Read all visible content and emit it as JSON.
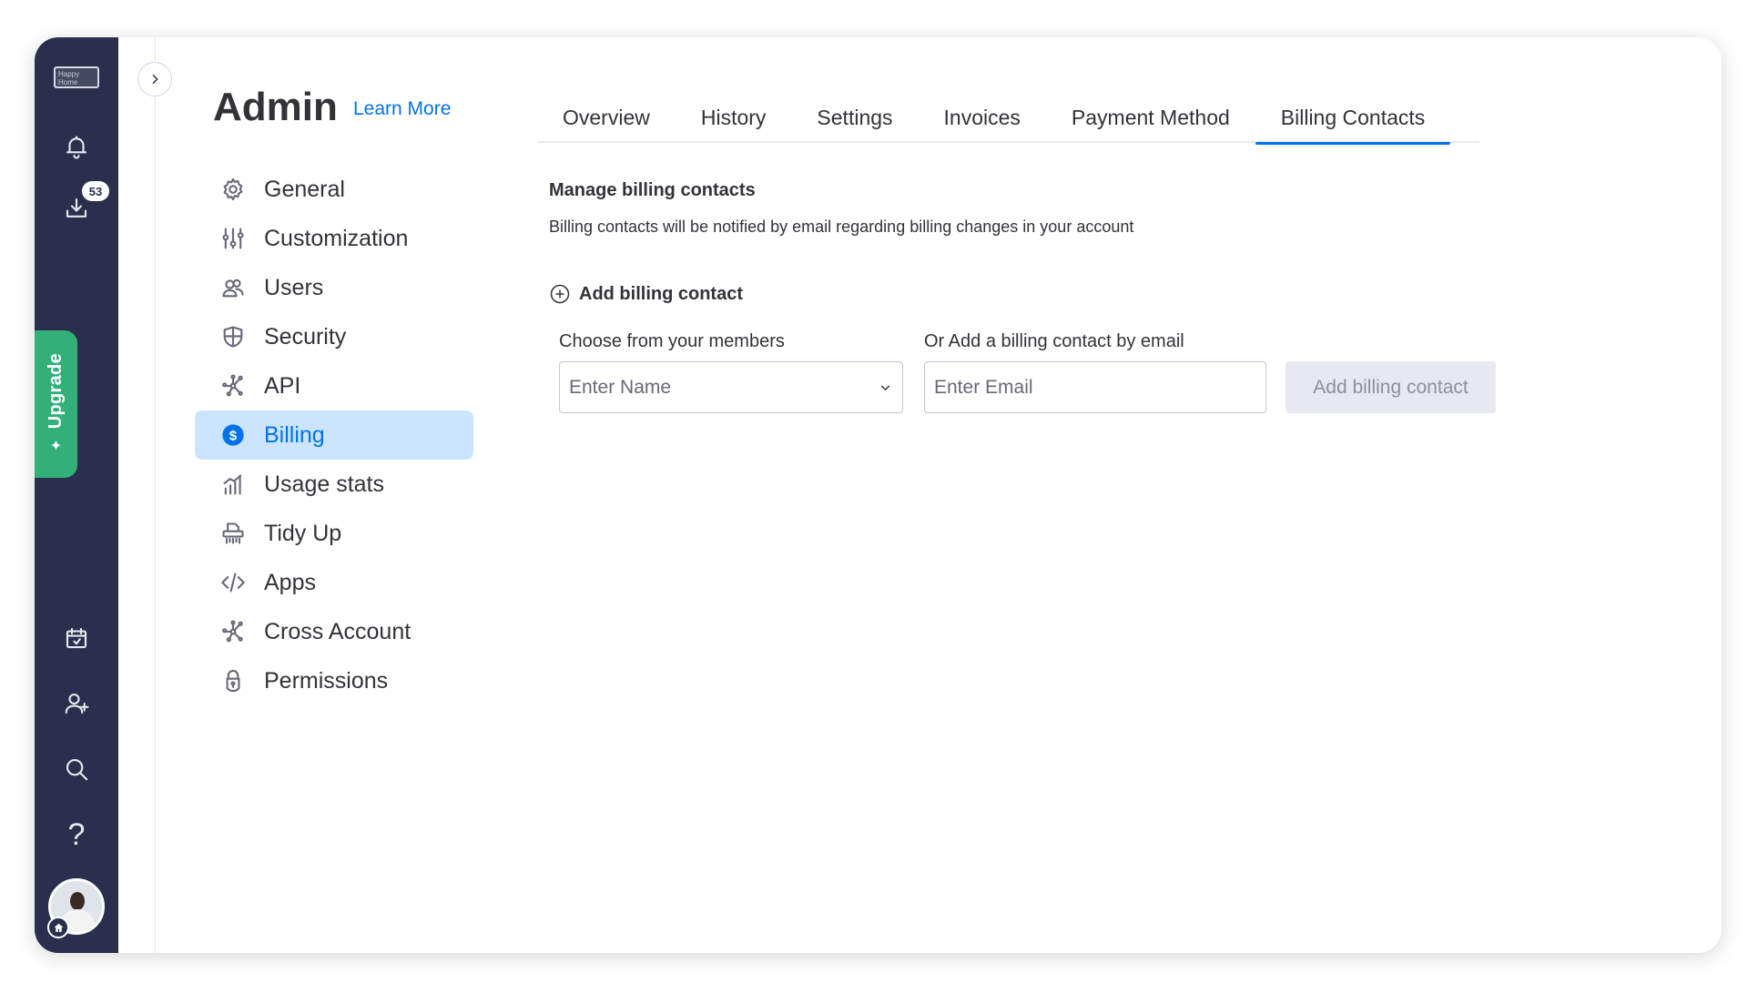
{
  "rail": {
    "logo_text": "Happy Home",
    "notification_count": "53",
    "upgrade_label": "Upgrade",
    "help_label": "?"
  },
  "header": {
    "title": "Admin",
    "learn_more": "Learn More"
  },
  "nav": {
    "items": [
      {
        "label": "General",
        "icon": "gear-icon"
      },
      {
        "label": "Customization",
        "icon": "sliders-icon"
      },
      {
        "label": "Users",
        "icon": "users-icon"
      },
      {
        "label": "Security",
        "icon": "shield-icon"
      },
      {
        "label": "API",
        "icon": "api-icon"
      },
      {
        "label": "Billing",
        "icon": "dollar-icon",
        "active": true
      },
      {
        "label": "Usage stats",
        "icon": "bar-chart-icon"
      },
      {
        "label": "Tidy Up",
        "icon": "shredder-icon"
      },
      {
        "label": "Apps",
        "icon": "code-icon"
      },
      {
        "label": "Cross Account",
        "icon": "network-icon"
      },
      {
        "label": "Permissions",
        "icon": "lock-icon"
      }
    ]
  },
  "tabs": [
    {
      "label": "Overview"
    },
    {
      "label": "History"
    },
    {
      "label": "Settings"
    },
    {
      "label": "Invoices"
    },
    {
      "label": "Payment Method"
    },
    {
      "label": "Billing Contacts",
      "active": true
    }
  ],
  "content": {
    "title": "Manage billing contacts",
    "description": "Billing contacts will be notified by email regarding billing changes in your account",
    "add_link": "Add billing contact",
    "members_label": "Choose from your members",
    "members_placeholder": "Enter Name",
    "email_label": "Or Add a billing contact by email",
    "email_placeholder": "Enter Email",
    "add_button": "Add billing contact"
  },
  "colors": {
    "rail": "#292f4c",
    "accent": "#0073ea",
    "active_bg": "#cce5ff",
    "upgrade": "#33b07a"
  }
}
